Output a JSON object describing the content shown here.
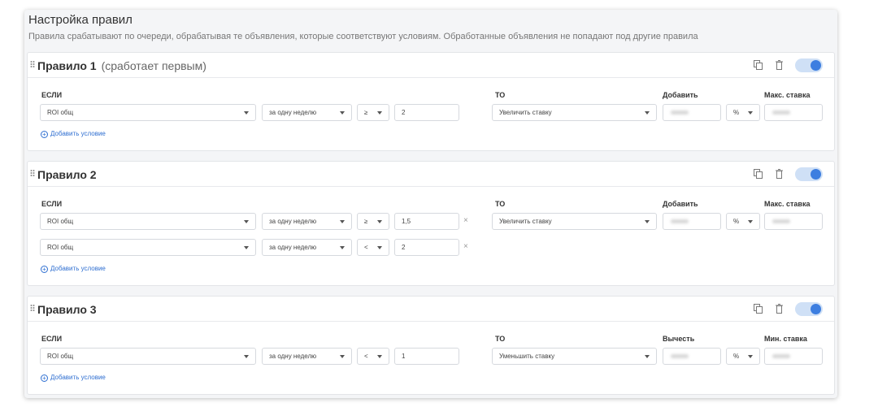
{
  "page": {
    "title": "Настройка правил",
    "subtitle": "Правила срабатывают по очереди, обрабатывая те объявления, которые соответствуют условиям. Обработанные объявления не попадают под другие правила"
  },
  "icons": {
    "drag": "drag-handle-icon",
    "copy": "copy-icon",
    "delete": "trash-icon",
    "toggle": "toggle-switch"
  },
  "colors": {
    "accent": "#3d7ee0",
    "toggle_track": "#cfe0f6",
    "link": "#2f6fd1"
  },
  "labels": {
    "if": "ЕСЛИ",
    "then": "ТО",
    "add_condition": "Добавить условие"
  },
  "rules": [
    {
      "title": "Правило 1",
      "note": "(сработает первым)",
      "enabled": true,
      "conditions": [
        {
          "metric": "ROI общ",
          "period": "за одну неделю",
          "operator": "≥",
          "value": "2"
        }
      ],
      "action": "Увеличить ставку",
      "amount_label": "Добавить",
      "unit": "%",
      "limit_label": "Макс. ставка"
    },
    {
      "title": "Правило 2",
      "note": "",
      "enabled": true,
      "conditions": [
        {
          "metric": "ROI общ",
          "period": "за одну неделю",
          "operator": "≥",
          "value": "1,5",
          "remove": "×"
        },
        {
          "metric": "ROI общ",
          "period": "за одну неделю",
          "operator": "<",
          "value": "2",
          "remove": "×"
        }
      ],
      "action": "Увеличить ставку",
      "amount_label": "Добавить",
      "unit": "%",
      "limit_label": "Макс. ставка"
    },
    {
      "title": "Правило 3",
      "note": "",
      "enabled": true,
      "conditions": [
        {
          "metric": "ROI общ",
          "period": "за одну неделю",
          "operator": "<",
          "value": "1"
        }
      ],
      "action": "Уменьшить ставку",
      "amount_label": "Вычесть",
      "unit": "%",
      "limit_label": "Мин. ставка"
    }
  ]
}
